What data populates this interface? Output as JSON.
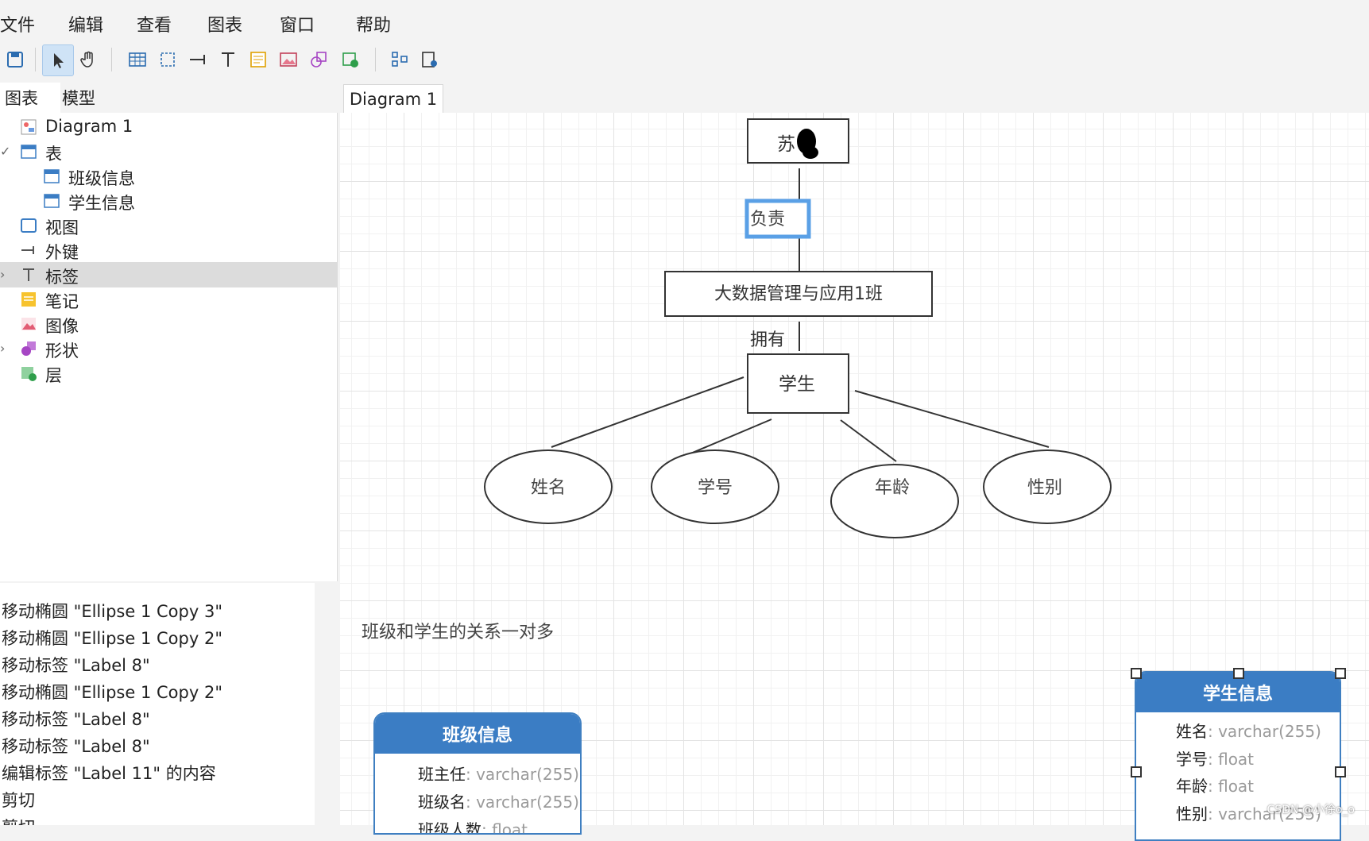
{
  "menu": [
    "文件",
    "编辑",
    "查看",
    "图表",
    "窗口",
    "帮助"
  ],
  "left_tabs": [
    "图表",
    "模型"
  ],
  "tree": [
    {
      "label": "Diagram 1",
      "icon": "diagram-icon",
      "indent": 1,
      "arrow": ""
    },
    {
      "label": "表",
      "icon": "table-icon",
      "indent": 1,
      "arrow": "✓"
    },
    {
      "label": "班级信息",
      "icon": "table-icon",
      "indent": 2,
      "arrow": ""
    },
    {
      "label": "学生信息",
      "icon": "table-icon",
      "indent": 2,
      "arrow": ""
    },
    {
      "label": "视图",
      "icon": "view-icon",
      "indent": 1,
      "arrow": ""
    },
    {
      "label": "外键",
      "icon": "foreign-key-icon",
      "indent": 1,
      "arrow": ""
    },
    {
      "label": "标签",
      "icon": "label-icon",
      "indent": 1,
      "arrow": "›",
      "selected": true
    },
    {
      "label": "笔记",
      "icon": "note-icon",
      "indent": 1,
      "arrow": ""
    },
    {
      "label": "图像",
      "icon": "image-icon",
      "indent": 1,
      "arrow": ""
    },
    {
      "label": "形状",
      "icon": "shape-icon",
      "indent": 1,
      "arrow": "›"
    },
    {
      "label": "层",
      "icon": "layer-icon",
      "indent": 1,
      "arrow": ""
    }
  ],
  "history": [
    "移动椭圆 \"Ellipse 1 Copy 3\"",
    "移动椭圆 \"Ellipse 1 Copy 2\"",
    "移动标签 \"Label 8\"",
    "移动椭圆 \"Ellipse 1 Copy 2\"",
    "移动标签 \"Label 8\"",
    "移动标签 \"Label 8\"",
    "编辑标签 \"Label 11\" 的内容",
    "剪切",
    "剪切"
  ],
  "doc_tab": "Diagram 1",
  "er": {
    "top_box": "苏",
    "relation_1": "负责",
    "class_box": "大数据管理与应用1班",
    "relation_2": "拥有",
    "student_box": "学生",
    "attributes": [
      "姓名",
      "学号",
      "年龄",
      "性别"
    ]
  },
  "note_text": "班级和学生的关系一对多",
  "class_table": {
    "title": "班级信息",
    "fields": [
      {
        "name": "班主任",
        "type": ": varchar(255)"
      },
      {
        "name": "班级名",
        "type": ": varchar(255)"
      },
      {
        "name": "班级人数",
        "type": ": float"
      }
    ]
  },
  "student_table": {
    "title": "学生信息",
    "fields": [
      {
        "name": "姓名",
        "type": ": varchar(255)"
      },
      {
        "name": "学号",
        "type": ": float"
      },
      {
        "name": "年龄",
        "type": ": float"
      },
      {
        "name": "性别",
        "type": ": varchar(255)"
      }
    ]
  },
  "watermark": "CSDN @小徐o_o",
  "colors": {
    "accent": "#3b7dc4",
    "selection": "#5aa0e6"
  }
}
